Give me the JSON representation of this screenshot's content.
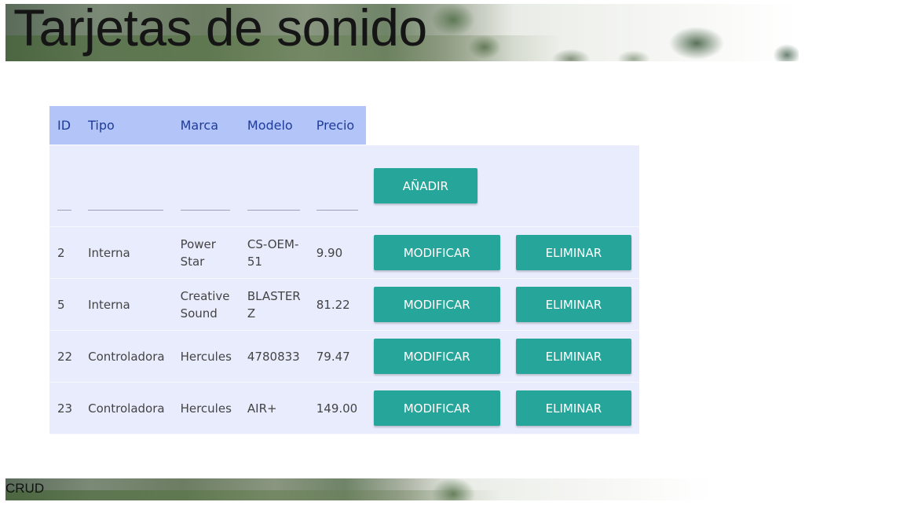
{
  "header": {
    "title": "Tarjetas de sonido"
  },
  "footer": {
    "text": "CRUD"
  },
  "table": {
    "columns": [
      "ID",
      "Tipo",
      "Marca",
      "Modelo",
      "Precio"
    ],
    "add_button": "AÑADIR",
    "modify_button": "MODIFICAR",
    "delete_button": "ELIMINAR",
    "rows": [
      {
        "id": "2",
        "tipo": "Interna",
        "marca": "Power Star",
        "modelo": "CS-OEM-51",
        "precio": "9.90"
      },
      {
        "id": "5",
        "tipo": "Interna",
        "marca": "Creative Sound",
        "modelo": "BLASTER Z",
        "precio": "81.22"
      },
      {
        "id": "22",
        "tipo": "Controladora",
        "marca": "Hercules",
        "modelo": "4780833",
        "precio": "79.47"
      },
      {
        "id": "23",
        "tipo": "Controladora",
        "marca": "Hercules",
        "modelo": "AIR+",
        "precio": "149.00"
      }
    ]
  }
}
